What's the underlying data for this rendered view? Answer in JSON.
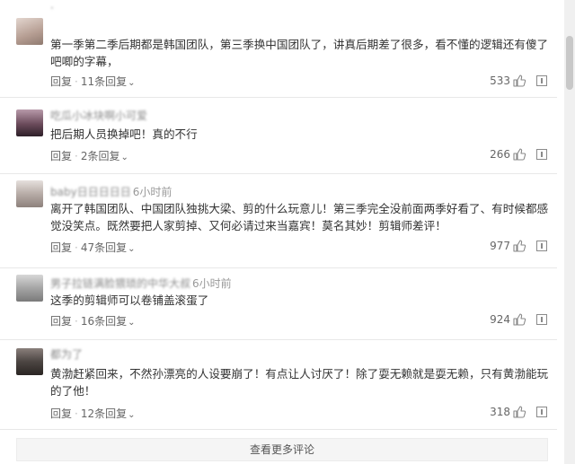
{
  "comments": [
    {
      "username": "·",
      "time": "",
      "text": "第一季第二季后期都是韩国团队，第三季换中国团队了，讲真后期差了很多，看不懂的逻辑还有傻了吧唧的字幕，",
      "reply_label": "回复",
      "replies_label": "11条回复",
      "likes": "533",
      "avatar_color": "#c9b6ad"
    },
    {
      "username": "吃瓜小冰块啊小可爱",
      "time": "",
      "text": "把后期人员换掉吧！真的不行",
      "reply_label": "回复",
      "replies_label": "2条回复",
      "likes": "266",
      "avatar_color": "#7a5a6a"
    },
    {
      "username": "baby日日日日日",
      "time": "6小时前",
      "text": "离开了韩国团队、中国团队独挑大梁、剪的什么玩意儿！第三季完全没前面两季好看了、有时候都感觉没笑点。既然要把人家剪掉、又何必请过来当嘉宾！莫名其妙！剪辑师差评！",
      "reply_label": "回复",
      "replies_label": "47条回复",
      "likes": "977",
      "avatar_color": "#b8b0ad"
    },
    {
      "username": "男子拉链满脸猥琐的中华大叔",
      "time": "6小时前",
      "text": "这季的剪辑师可以卷铺盖滚蛋了",
      "reply_label": "回复",
      "replies_label": "16条回复",
      "likes": "924",
      "avatar_color": "#a9a9a9"
    },
    {
      "username": "都为了",
      "time": "",
      "text": "黄渤赶紧回来，不然孙漂亮的人设要崩了！有点让人讨厌了！除了耍无赖就是耍无赖，只有黄渤能玩的了他！",
      "reply_label": "回复",
      "replies_label": "12条回复",
      "likes": "318",
      "avatar_color": "#5b5350"
    }
  ],
  "icons": {
    "reply_chevron": "chevron-down-icon",
    "like": "thumbs-up-icon",
    "report": "report-icon"
  },
  "more_comments_label": "查看更多评论",
  "colors": {
    "text": "#333333",
    "meta": "#666666",
    "divider": "#e8e8e8"
  }
}
